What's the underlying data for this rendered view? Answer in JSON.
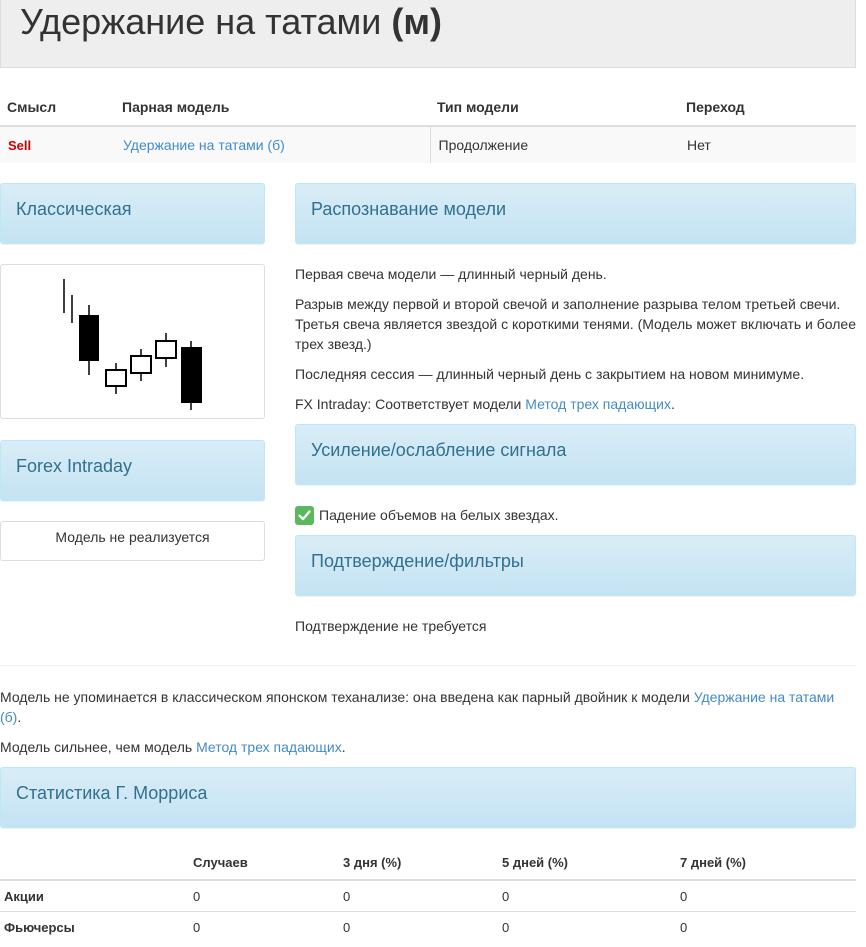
{
  "header": {
    "title": "Удержание на татами",
    "suffix": "(м)"
  },
  "info_table": {
    "headers": [
      "Смысл",
      "Парная модель",
      "Тип модели",
      "Переход"
    ],
    "row": {
      "signal": "Sell",
      "paired": "Удержание на татами (б)",
      "type": "Продолжение",
      "transition": "Нет"
    }
  },
  "classic": {
    "title": "Классическая"
  },
  "forex": {
    "title": "Forex Intraday",
    "text": "Модель не реализуется"
  },
  "recognition": {
    "title": "Распознавание модели",
    "p1": "Первая свеча модели — длинный черный день.",
    "p2": "Разрыв между первой и второй свечой и заполнение разрыва телом третьей свечи. Третья свеча является звездой с короткими тенями. (Модель может включать и более трех звезд.)",
    "p3": "Последняя сессия — длинный черный день с закрытием на новом минимуме.",
    "p4_prefix": "FX Intraday: Соответствует модели ",
    "p4_link": "Метод трех падающих",
    "p4_suffix": "."
  },
  "signal": {
    "title": "Усиление/ослабление сигнала",
    "item": "Падение объемов на белых звездах."
  },
  "confirm": {
    "title": "Подтверждение/фильтры",
    "text": "Подтверждение не требуется"
  },
  "notes": {
    "n1_prefix": "Модель не упоминается в классическом японском теханализе: она введена как парный двойник к модели ",
    "n1_link": "Удержание на татами (б)",
    "n1_suffix": ".",
    "n2_prefix": "Модель сильнее, чем модель ",
    "n2_link": "Метод трех падающих",
    "n2_suffix": "."
  },
  "stats": {
    "title": "Статистика Г. Морриса",
    "headers": [
      "",
      "Случаев",
      "3 дня (%)",
      "5 дней (%)",
      "7 дней (%)"
    ],
    "rows": [
      {
        "label": "Акции",
        "values": [
          "0",
          "0",
          "0",
          "0"
        ]
      },
      {
        "label": "Фьючерсы",
        "values": [
          "0",
          "0",
          "0",
          "0"
        ]
      }
    ]
  },
  "colors": {
    "sell": "#cc0000",
    "link": "#428bca",
    "panel_text": "#31708f",
    "check": "#5cb85c"
  }
}
